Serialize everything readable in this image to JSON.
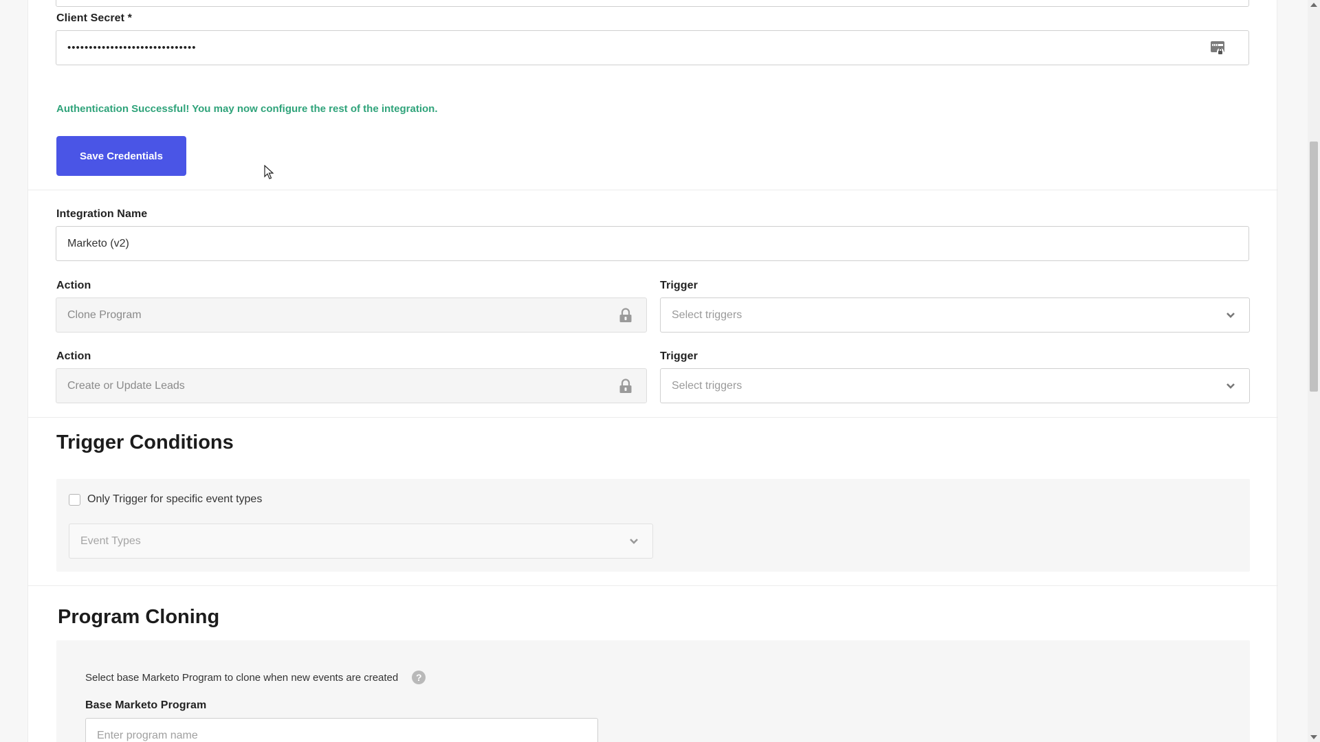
{
  "credentials": {
    "client_secret_label": "Client Secret *",
    "client_secret_value": "••••••••••••••••••••••••••••••",
    "auth_message": "Authentication Successful! You may now configure the rest of the integration.",
    "save_button": "Save Credentials"
  },
  "integration": {
    "name_label": "Integration Name",
    "name_value": "Marketo (v2)",
    "rows": [
      {
        "action_label": "Action",
        "action_value": "Clone Program",
        "trigger_label": "Trigger",
        "trigger_placeholder": "Select triggers"
      },
      {
        "action_label": "Action",
        "action_value": "Create or Update Leads",
        "trigger_label": "Trigger",
        "trigger_placeholder": "Select triggers"
      }
    ]
  },
  "trigger_conditions": {
    "title": "Trigger Conditions",
    "checkbox_label": "Only Trigger for specific event types",
    "event_types_placeholder": "Event Types"
  },
  "program_cloning": {
    "title": "Program Cloning",
    "description": "Select base Marketo Program to clone when new events are created",
    "help_glyph": "?",
    "base_program_label": "Base Marketo Program",
    "base_program_placeholder": "Enter program name"
  },
  "icons": {
    "password_manager": "password-manager-icon",
    "lock": "lock-icon",
    "chevron": "chevron-down-icon",
    "help": "help-icon"
  },
  "colors": {
    "primary": "#4a55e6",
    "success": "#2fa37a",
    "background": "#f7f7f7"
  }
}
